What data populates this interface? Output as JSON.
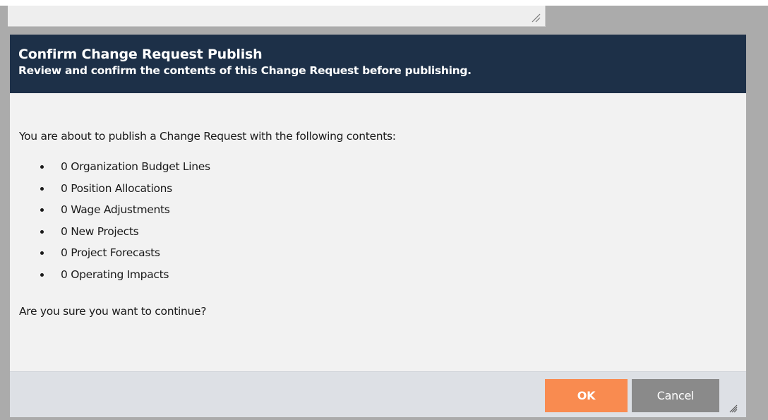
{
  "dialog": {
    "title": "Confirm Change Request Publish",
    "subtitle": "Review and confirm the contents of this Change Request before publishing.",
    "intro": "You are about to publish a Change Request with the following contents:",
    "items": [
      "0 Organization Budget Lines",
      "0 Position Allocations",
      "0 Wage Adjustments",
      "0 New Projects",
      "0 Project Forecasts",
      "0 Operating Impacts"
    ],
    "question": "Are you sure you want to continue?",
    "buttons": {
      "ok_label": "OK",
      "cancel_label": "Cancel"
    }
  },
  "colors": {
    "header_bg": "#1d3048",
    "ok_button": "#f98b50",
    "cancel_button": "#8a8a8a",
    "body_bg": "#f2f2f2",
    "footer_bg": "#dde0e5",
    "overlay": "#ababab"
  },
  "icons": {
    "background_textarea_grip": "resize-grip-icon",
    "dialog_grip": "resize-grip-icon"
  }
}
